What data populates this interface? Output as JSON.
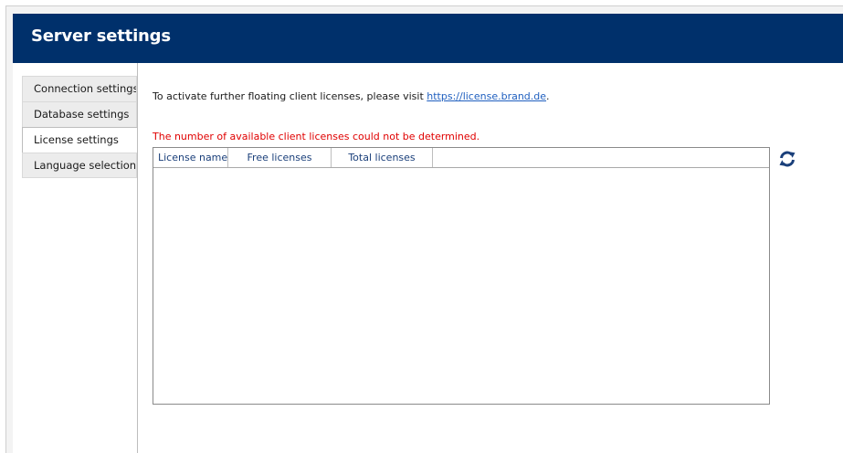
{
  "header": {
    "title": "Server settings"
  },
  "tabs": [
    {
      "label": "Connection settings",
      "active": false
    },
    {
      "label": "Database settings",
      "active": false
    },
    {
      "label": "License settings",
      "active": true
    },
    {
      "label": "Language selection",
      "active": false
    }
  ],
  "license": {
    "info_text": "To activate further floating client licenses, please visit ",
    "link_text": "https://license.brand.de",
    "info_suffix": ".",
    "error_text": "The number of available client licenses could not be determined.",
    "columns": [
      "License name",
      "Free licenses",
      "Total licenses"
    ],
    "rows": [],
    "refresh_icon": "refresh-icon"
  },
  "colors": {
    "header_bg": "#00306b",
    "error": "#e00000",
    "link": "#1f5fbf",
    "column_header": "#1a3f7a"
  }
}
